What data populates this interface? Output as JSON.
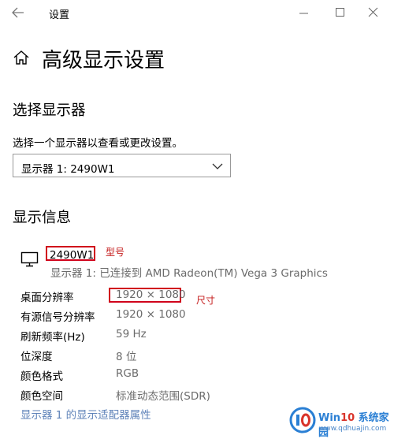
{
  "window": {
    "title": "设置"
  },
  "page": {
    "title": "高级显示设置"
  },
  "select_display": {
    "heading": "选择显示器",
    "description": "选择一个显示器以查看或更改设置。",
    "dropdown_value": "显示器 1: 2490W1"
  },
  "display_info": {
    "heading": "显示信息",
    "model": "2490W1",
    "model_annotation": "型号",
    "connection": "显示器 1: 已连接到 AMD Radeon(TM) Vega 3 Graphics",
    "size_annotation": "尺寸",
    "rows": [
      {
        "label": "桌面分辨率",
        "value": "1920 × 1080"
      },
      {
        "label": "有源信号分辨率",
        "value": "1920 × 1080"
      },
      {
        "label": "刷新频率(Hz)",
        "value": "59 Hz"
      },
      {
        "label": "位深度",
        "value": "8 位"
      },
      {
        "label": "颜色格式",
        "value": "RGB"
      },
      {
        "label": "颜色空间",
        "value": "标准动态范围(SDR)"
      }
    ],
    "adapter_link": "显示器 1 的显示适配器属性"
  },
  "watermark": {
    "line1_prefix": "Win",
    "line1_accent": "10",
    "line1_suffix": " 系统家园",
    "line2": "www.qdhuajin.com"
  },
  "colors": {
    "highlight_box": "#d0021b",
    "annotation_text": "#c41a1a",
    "link": "#5f83b9",
    "secondary_text": "#6b6b6b"
  },
  "icons": [
    "back-arrow-icon",
    "minimize-icon",
    "maximize-icon",
    "close-icon",
    "home-icon",
    "chevron-down-icon",
    "monitor-icon"
  ]
}
